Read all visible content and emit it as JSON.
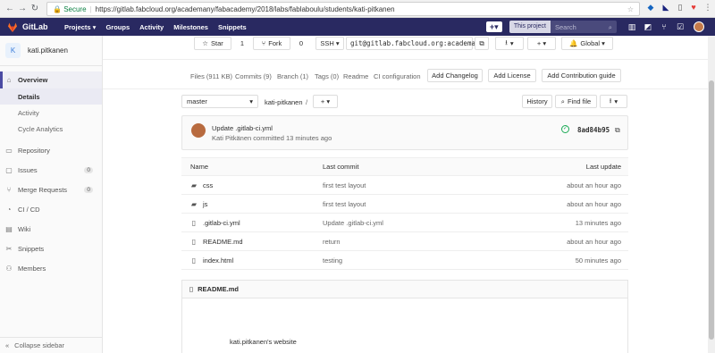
{
  "browser": {
    "secure": "Secure",
    "url": "https://gitlab.fabcloud.org/academany/fabacademy/2018/labs/fablaboulu/students/kati-pitkanen"
  },
  "topnav": {
    "brand": "GitLab",
    "projects": "Projects ▾",
    "groups": "Groups",
    "activity": "Activity",
    "milestones": "Milestones",
    "snippets": "Snippets",
    "this_project": "This project",
    "search_placeholder": "Search"
  },
  "sidebar": {
    "avatar_letter": "K",
    "project": "kati.pitkanen",
    "overview": "Overview",
    "details": "Details",
    "activity": "Activity",
    "cycle": "Cycle Analytics",
    "repository": "Repository",
    "issues": "Issues",
    "issues_count": "0",
    "merge": "Merge Requests",
    "merge_count": "0",
    "cicd": "CI / CD",
    "wiki": "Wiki",
    "snippets": "Snippets",
    "members": "Members",
    "collapse": "Collapse sidebar"
  },
  "actions": {
    "star": "Star",
    "star_count": "1",
    "fork": "Fork",
    "fork_count": "0",
    "ssh": "SSH ▾",
    "clone_url": "git@gitlab.fabcloud.org:academany",
    "download": "▾",
    "add": "+ ▾",
    "visibility": "Global ▾"
  },
  "stats": {
    "files": "Files (911 KB)",
    "commits": "Commits (9)",
    "branch": "Branch (1)",
    "tags": "Tags (0)",
    "readme": "Readme",
    "ci": "CI configuration",
    "add_changelog": "Add Changelog",
    "add_license": "Add License",
    "add_contrib": "Add Contribution guide"
  },
  "tree": {
    "branch": "master",
    "path": "kati-pitkanen",
    "sep": "/",
    "plus": "+ ▾",
    "history": "History",
    "find": "Find file",
    "download": "▾"
  },
  "commit": {
    "title": "Update .gitlab-ci.yml",
    "meta": "Kati Pitkänen committed 13 minutes ago",
    "sha": "8ad84b95"
  },
  "table": {
    "headers": [
      "Name",
      "Last commit",
      "Last update"
    ],
    "rows": [
      {
        "name": "css",
        "commit": "first test layout",
        "update": "about an hour ago",
        "icon": "folder-icon"
      },
      {
        "name": "js",
        "commit": "first test layout",
        "update": "about an hour ago",
        "icon": "folder-icon"
      },
      {
        "name": ".gitlab-ci.yml",
        "commit": "Update .gitlab-ci.yml",
        "update": "13 minutes ago",
        "icon": "file-icon"
      },
      {
        "name": "README.md",
        "commit": "return",
        "update": "about an hour ago",
        "icon": "file-icon"
      },
      {
        "name": "index.html",
        "commit": "testing",
        "update": "50 minutes ago",
        "icon": "file-icon"
      }
    ]
  },
  "readme": {
    "title": "README.md",
    "body": "kati.pitkanen's website"
  },
  "colors": {
    "navbar": "#292961",
    "accent": "#4b4ba3",
    "success": "#1aaa55"
  }
}
